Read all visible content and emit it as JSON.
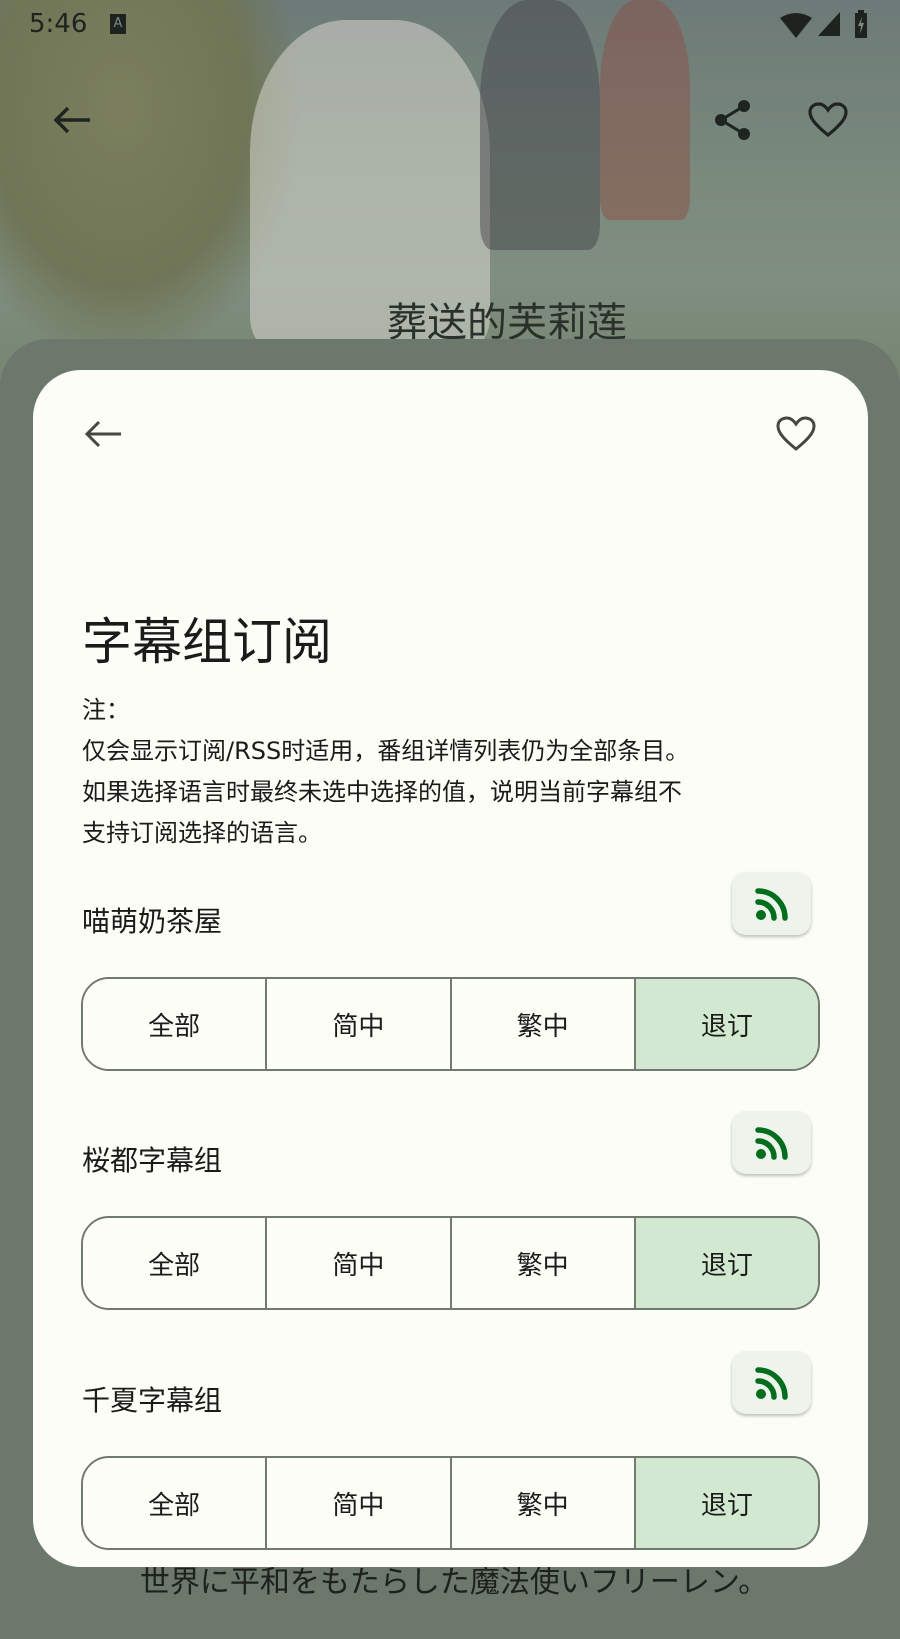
{
  "status_bar": {
    "time": "5:46",
    "notification_icon": "A"
  },
  "top_bar": {
    "back_icon": "arrow-left",
    "share_icon": "share",
    "favorite_icon": "heart-outline"
  },
  "background": {
    "title": "葬送的芙莉莲",
    "description_line": "世界に平和をもたらした魔法使いフリーレン。"
  },
  "dialog": {
    "title": "字幕组订阅",
    "note_lines": [
      "注：",
      "仅会显示订阅/RSS时适用，番组详情列表仍为全部条目。",
      "如果选择语言时最终未选中选择的值，说明当前字幕组不",
      "支持订阅选择的语言。"
    ],
    "groups": [
      {
        "name": "喵萌奶茶屋",
        "options": [
          "全部",
          "简中",
          "繁中",
          "退订"
        ],
        "selected": "退订"
      },
      {
        "name": "桜都字幕组",
        "options": [
          "全部",
          "简中",
          "繁中",
          "退订"
        ],
        "selected": "退订"
      },
      {
        "name": "千夏字幕组",
        "options": [
          "全部",
          "简中",
          "繁中",
          "退订"
        ],
        "selected": "退订"
      }
    ]
  },
  "colors": {
    "accent": "#006e1c",
    "selected_segment": "#d3e8d0",
    "surface": "#fcfdf7",
    "scrim": "#67716a"
  }
}
